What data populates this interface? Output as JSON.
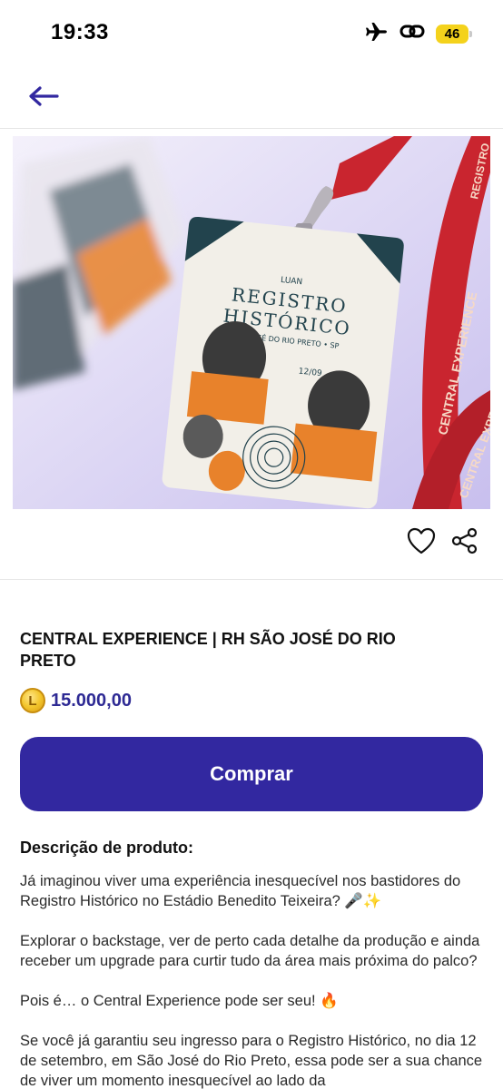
{
  "status_bar": {
    "time": "19:33",
    "battery": "46",
    "icons": [
      "airplane-icon",
      "link-icon",
      "battery-icon"
    ]
  },
  "header": {
    "back_icon": "arrow-left-icon",
    "accent_color": "#3228a0"
  },
  "hero": {
    "badge_small": "LUAN",
    "badge_title_line1": "REGISTRO",
    "badge_title_line2": "HISTÓRICO",
    "badge_location": "SÃO JOSÉ DO RIO PRETO • SP",
    "badge_date": "12/09",
    "lanyard_text": "CENTRAL EXPERIENCE",
    "lanyard_text_2": "REGISTRO"
  },
  "actions": {
    "favorite_icon": "heart-icon",
    "share_icon": "share-icon"
  },
  "product": {
    "title": "CENTRAL EXPERIENCE | RH SÃO JOSÉ DO RIO PRETO",
    "coin_letter": "L",
    "price": "15.000,00"
  },
  "buy_button": {
    "label": "Comprar",
    "color": "#3228a0"
  },
  "description": {
    "heading": "Descrição de produto:",
    "paragraphs": [
      "Já imaginou viver uma experiência inesquecível nos bastidores do Registro Histórico no Estádio Benedito Teixeira? 🎤✨",
      "Explorar o backstage, ver de perto cada detalhe da produção e ainda receber um upgrade para curtir tudo da área mais próxima do palco?",
      "Pois é… o Central Experience pode ser seu! 🔥",
      "Se você já garantiu seu ingresso para o Registro Histórico, no dia 12 de setembro, em São José do Rio Preto, essa pode ser a sua chance de viver um momento inesquecível ao lado da"
    ]
  }
}
